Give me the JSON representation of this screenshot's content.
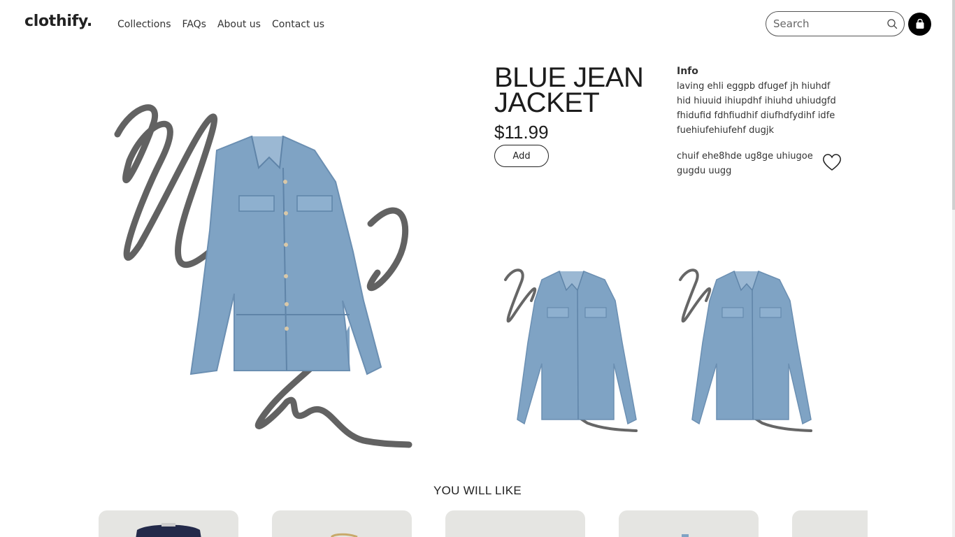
{
  "header": {
    "logo": "clothify.",
    "nav": [
      "Collections",
      "FAQs",
      "About us",
      "Contact us"
    ],
    "search_placeholder": "Search"
  },
  "product": {
    "title": "BLUE JEAN JACKET",
    "price": "$11.99",
    "add_label": "Add",
    "info_heading": "Info",
    "info_text": "laving ehli eggpb dfugef jh hiuhdf hid hiuuid ihiupdhf ihiuhd uhiudgfd fhidufid fdhfiudhif diufhdfydihf idfe fuehiufehiufehf dugjk",
    "extra_text": "chuif ehe8hde ug8ge uhiugoe gugdu uugg"
  },
  "recommendations": {
    "title": "YOU WILL LIKE"
  },
  "colors": {
    "accent": "#000000",
    "denim": "#7fa3c4",
    "card_bg": "#e5e5e2",
    "scribble": "#555555"
  }
}
